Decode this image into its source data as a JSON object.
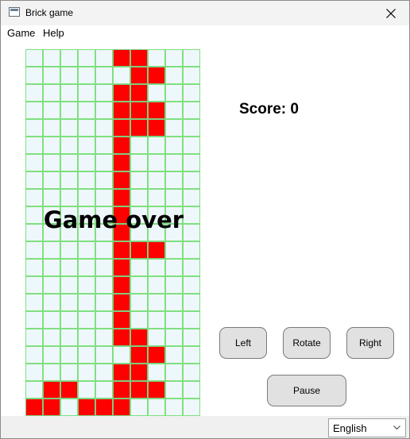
{
  "window": {
    "title": "Brick game",
    "icon": "app-window-icon",
    "close_icon": "close-icon"
  },
  "menu": {
    "items": [
      {
        "label": "Game"
      },
      {
        "label": "Help"
      }
    ]
  },
  "board": {
    "columns": 10,
    "rows": 20,
    "cell_color": "#eef7fb",
    "grid_line_color": "#7fe07f",
    "brick_color": "#ff0000",
    "filled": [
      [
        0,
        5
      ],
      [
        0,
        6
      ],
      [
        1,
        6
      ],
      [
        1,
        7
      ],
      [
        2,
        5
      ],
      [
        2,
        6
      ],
      [
        3,
        5
      ],
      [
        3,
        6
      ],
      [
        3,
        7
      ],
      [
        4,
        5
      ],
      [
        4,
        6
      ],
      [
        4,
        7
      ],
      [
        5,
        5
      ],
      [
        6,
        5
      ],
      [
        7,
        5
      ],
      [
        8,
        5
      ],
      [
        9,
        5
      ],
      [
        10,
        5
      ],
      [
        11,
        5
      ],
      [
        11,
        6
      ],
      [
        11,
        7
      ],
      [
        12,
        5
      ],
      [
        13,
        5
      ],
      [
        14,
        5
      ],
      [
        15,
        5
      ],
      [
        16,
        5
      ],
      [
        16,
        6
      ],
      [
        17,
        6
      ],
      [
        17,
        7
      ],
      [
        18,
        5
      ],
      [
        18,
        6
      ],
      [
        19,
        1
      ],
      [
        19,
        2
      ],
      [
        19,
        5
      ],
      [
        19,
        6
      ],
      [
        19,
        7
      ],
      [
        20,
        0
      ],
      [
        20,
        1
      ],
      [
        20,
        3
      ],
      [
        20,
        4
      ],
      [
        20,
        5
      ]
    ],
    "overlay_text": "Game over"
  },
  "score": {
    "text": "Score: 0"
  },
  "controls": {
    "left_label": "Left",
    "rotate_label": "Rotate",
    "right_label": "Right",
    "pause_label": "Pause"
  },
  "language": {
    "selected": "English",
    "chevron_icon": "chevron-down-icon"
  }
}
